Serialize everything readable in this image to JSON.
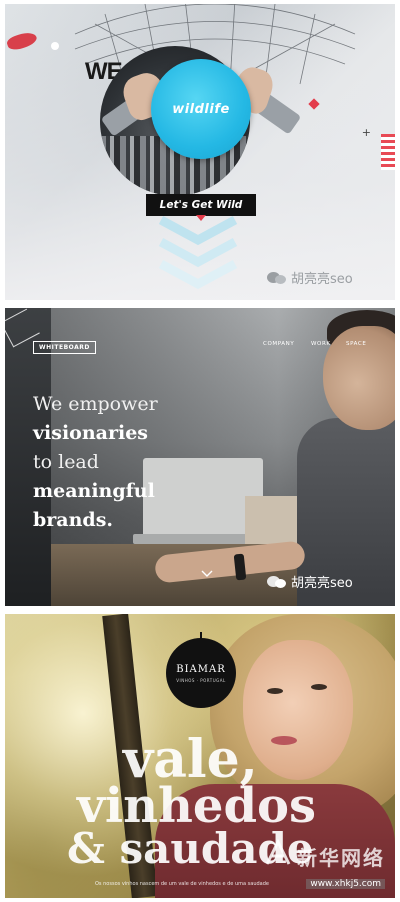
{
  "panels": {
    "wildlife": {
      "headline": "WE ARE",
      "disc_logo": "wildlife",
      "cta_label": "Let's Get Wild",
      "watermark": "胡亮亮seo"
    },
    "whiteboard": {
      "logo": "WHITEBOARD",
      "nav": [
        "COMPANY",
        "WORK",
        "SPACE"
      ],
      "headline_lines": [
        "We empower",
        "visionaries",
        "to lead",
        "meaningful",
        "brands."
      ],
      "watermark": "胡亮亮seo"
    },
    "biamar": {
      "brand": "BIAMAR",
      "brand_sub": "VINHOS · PORTUGAL",
      "big_lines": [
        "vale,",
        "vinhedos",
        "& saudade"
      ],
      "footer_text": "Os nossos vinhos nascem de um vale de vinhedos e de uma saudade",
      "watermark_cn": "新华网络",
      "watermark_url": "www.xhkj5.com"
    }
  },
  "colors": {
    "accent_blue": "#24b8e4",
    "accent_red": "#e33c4b",
    "dark": "#111111"
  },
  "icons": {
    "wechat": "wechat-icon",
    "scroll": "chevron-down-icon"
  }
}
